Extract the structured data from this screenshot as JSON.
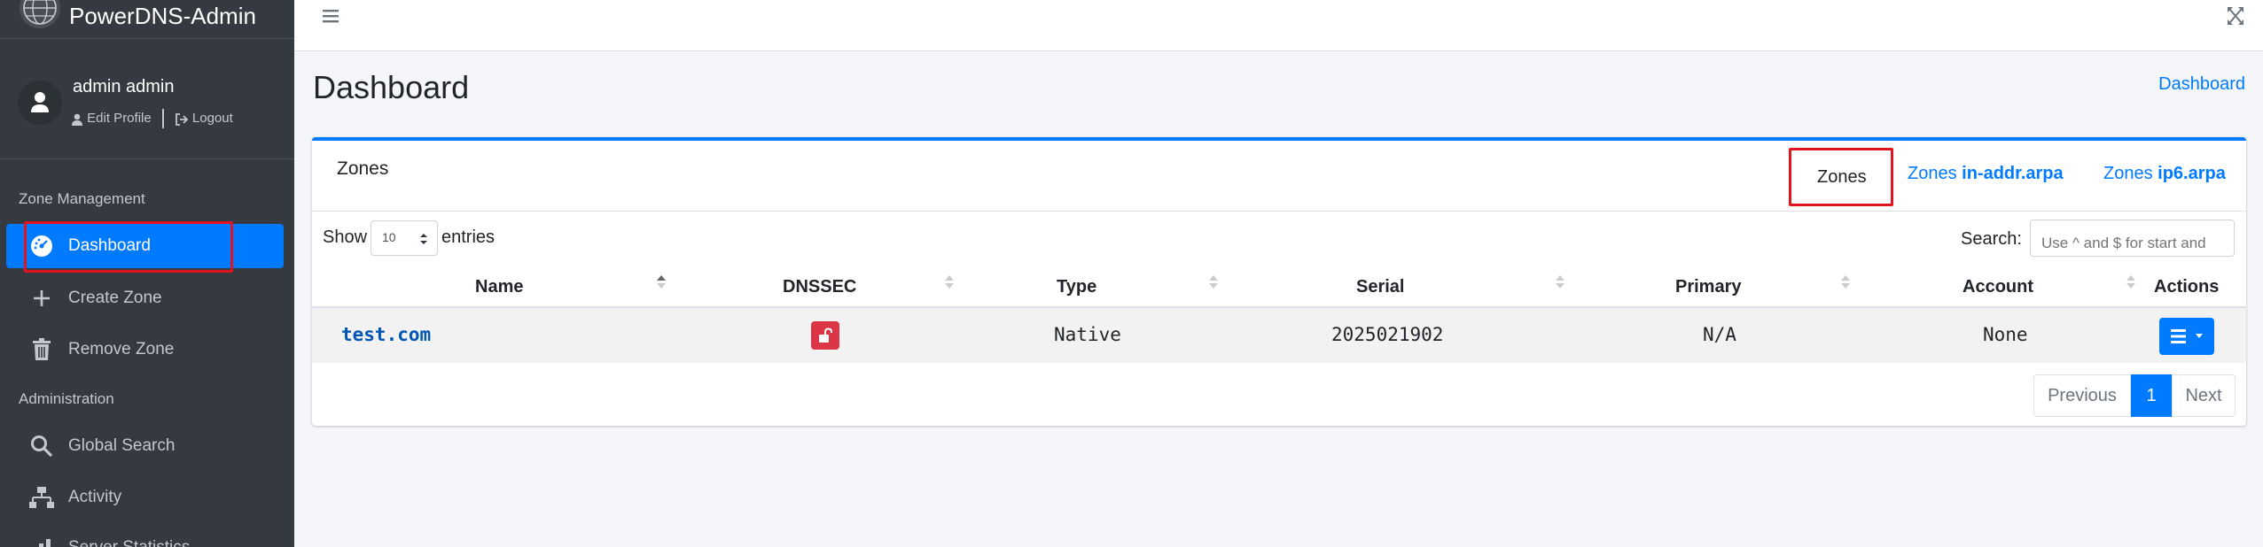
{
  "brand": {
    "title": "PowerDNS-Admin"
  },
  "user": {
    "name": "admin admin",
    "edit_profile": "Edit Profile",
    "logout": "Logout"
  },
  "sidebar": {
    "sections": [
      {
        "header": "Zone Management"
      },
      {
        "header": "Administration"
      }
    ],
    "items": [
      {
        "label": "Dashboard",
        "icon": "dashboard-icon",
        "active": true
      },
      {
        "label": "Create Zone",
        "icon": "plus-icon"
      },
      {
        "label": "Remove Zone",
        "icon": "trash-icon"
      },
      {
        "label": "Global Search",
        "icon": "search-icon"
      },
      {
        "label": "Activity",
        "icon": "activity-icon"
      },
      {
        "label": "Server Statistics",
        "icon": "chart-icon"
      }
    ]
  },
  "page": {
    "title": "Dashboard",
    "breadcrumb": "Dashboard"
  },
  "card": {
    "title": "Zones",
    "tabs": [
      {
        "prefix": "Zones",
        "bold": ""
      },
      {
        "prefix": "Zones",
        "bold": "in-addr.arpa"
      },
      {
        "prefix": "Zones",
        "bold": "ip6.arpa"
      }
    ],
    "show_label": "Show",
    "page_length": "10",
    "entries_label": "entries",
    "search_label": "Search:",
    "search_placeholder": "Use ^ and $ for start and",
    "columns": [
      "Name",
      "DNSSEC",
      "Type",
      "Serial",
      "Primary",
      "Account",
      "Actions"
    ],
    "rows": [
      {
        "name": "test.com",
        "dnssec": "unlocked",
        "type": "Native",
        "serial": "2025021902",
        "primary": "N/A",
        "account": "None"
      }
    ],
    "pagination": {
      "previous": "Previous",
      "current": "1",
      "next": "Next"
    }
  },
  "colors": {
    "accent": "#007bff",
    "sidebar_bg": "#343a40",
    "danger": "#dc3545",
    "highlight_box": "#e0141e"
  }
}
